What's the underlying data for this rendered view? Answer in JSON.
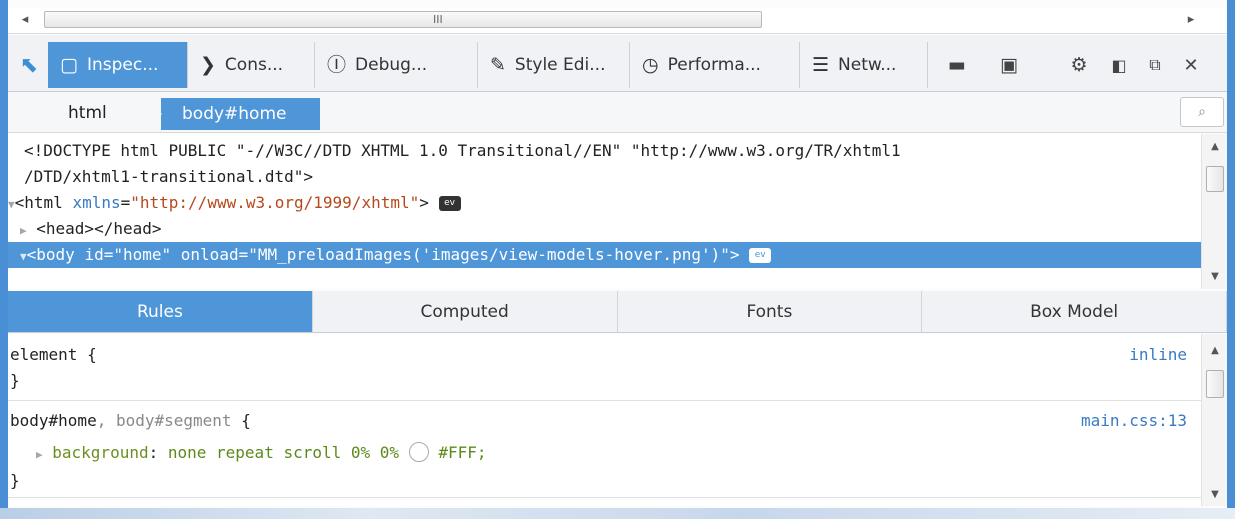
{
  "hscroll": {
    "left_arrow": "◂",
    "right_arrow": "▸",
    "grip": "III"
  },
  "toolbar": {
    "tabs": [
      {
        "label": "Inspec...",
        "icon": "inspector-icon"
      },
      {
        "label": "Cons...",
        "icon": "console-icon"
      },
      {
        "label": "Debug...",
        "icon": "debugger-icon"
      },
      {
        "label": "Style Edi...",
        "icon": "style-editor-icon"
      },
      {
        "label": "Performa...",
        "icon": "performance-icon"
      },
      {
        "label": "Netw...",
        "icon": "network-icon"
      }
    ],
    "buttons": [
      "split-console-icon",
      "responsive-mode-icon",
      "settings-gear-icon",
      "dock-side-icon",
      "undock-window-icon",
      "close-icon"
    ]
  },
  "breadcrumb": {
    "items": [
      "html",
      "body#home"
    ]
  },
  "markup": {
    "line1": "<!DOCTYPE html PUBLIC \"-//W3C//DTD XHTML 1.0 Transitional//EN\" \"http://www.w3.org/TR/xhtml1",
    "line2": "/DTD/xhtml1-transitional.dtd\">",
    "html_open": "<html",
    "html_attr": "xmlns",
    "html_val": "\"http://www.w3.org/1999/xhtml\"",
    "html_close": ">",
    "head": "<head></head>",
    "body_open": "<body",
    "body_attr1": "id",
    "body_val1": "\"home\"",
    "body_attr2": "onload",
    "body_val2": "\"MM_preloadImages('images/view-models-hover.png')\"",
    "body_close": ">",
    "ev_badge": "ev"
  },
  "sidebar_tabs": [
    "Rules",
    "Computed",
    "Fonts",
    "Box Model"
  ],
  "rules": {
    "rule1_selector": "element {",
    "rule1_close": "}",
    "rule1_source": "inline",
    "rule2_selector_main": "body#home",
    "rule2_selector_other": ", body#segment",
    "rule2_open": " {",
    "rule2_source": "main.css:13",
    "rule2_prop": "background",
    "rule2_value": "none repeat scroll 0% 0%",
    "rule2_color": "#FFF;",
    "rule2_close": "}"
  }
}
